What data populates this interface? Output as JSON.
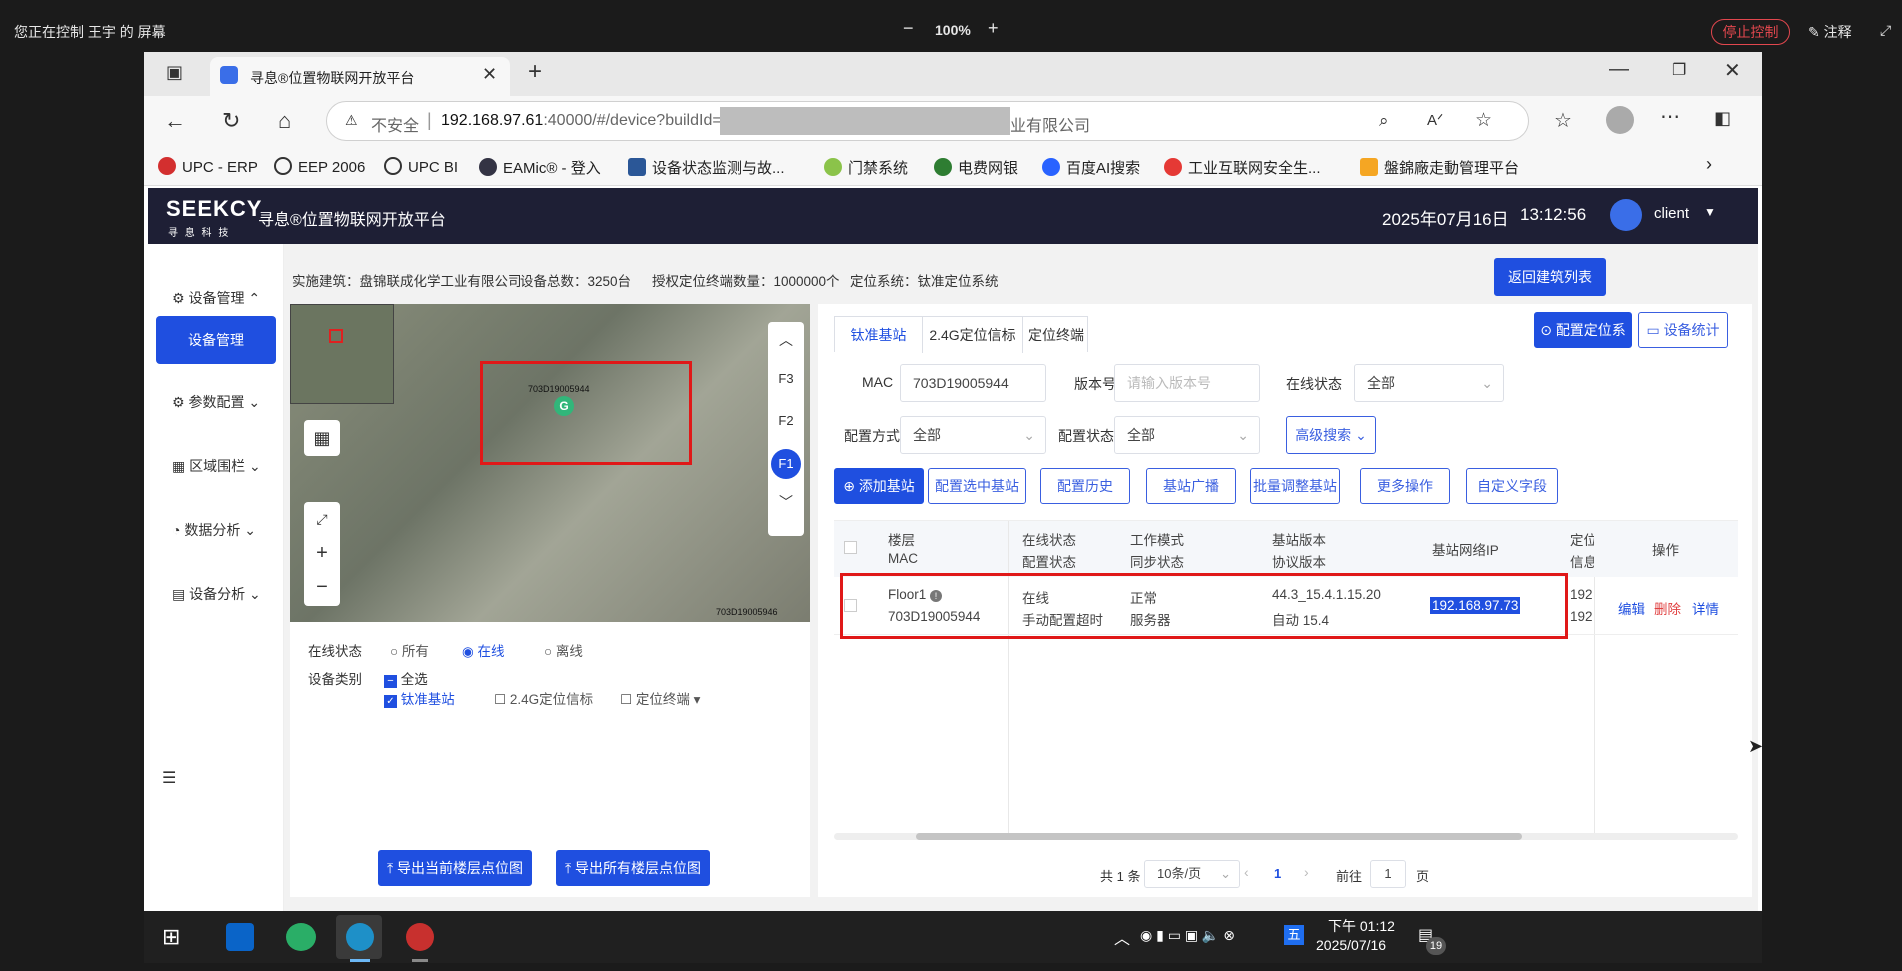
{
  "remote_bar": {
    "status": "您正在控制 王宇 的 屏幕",
    "zoom": "100%",
    "minus": "−",
    "plus": "+",
    "stop": "停止控制",
    "annotate": "注释"
  },
  "browser": {
    "tab_title": "寻息®位置物联网开放平台",
    "insecure": "不安全",
    "url_host": "192.168.97.61",
    "url_rest": ":40000/#/device?buildId=2077",
    "url_tail": "业有限公司",
    "bookmarks": [
      "UPC - ERP",
      "EEP 2006",
      "UPC BI",
      "EAMic® - 登入",
      "设备状态监测与故...",
      "门禁系统",
      "电费网银",
      "百度AI搜索",
      "工业互联网安全生...",
      "盤錦廠走動管理平台"
    ]
  },
  "header": {
    "logo": "SEEKCY",
    "logo_sub": "寻 息 科 技",
    "title": "寻息®位置物联网开放平台",
    "date": "2025年07月16日",
    "time": "13:12:56",
    "user": "client"
  },
  "sidebar": {
    "items": [
      "设备管理",
      "参数配置",
      "区域围栏",
      "数据分析",
      "设备分析"
    ],
    "active": "设备管理"
  },
  "info_bar": {
    "building": "实施建筑：盘锦联成化学工业有限公司",
    "total": "设备总数：3250台",
    "licensed": "授权定位终端数量：1000000个",
    "system": "定位系统：钛准定位系统",
    "back_button": "返回建筑列表"
  },
  "map": {
    "marker_label": "703D19005944",
    "corner_label": "703D19005946",
    "floors": [
      "F3",
      "F2",
      "F1"
    ],
    "active_floor": "F1",
    "online_label": "在线状态",
    "online_options": [
      "所有",
      "在线",
      "离线"
    ],
    "online_selected": "在线",
    "type_label": "设备类别",
    "types": [
      "全选",
      "钛准基站",
      "2.4G定位信标",
      "定位终端"
    ],
    "export_current": "导出当前楼层点位图",
    "export_all": "导出所有楼层点位图"
  },
  "tabs": [
    "钛准基站",
    "2.4G定位信标",
    "定位终端"
  ],
  "top_buttons": {
    "config_system": "配置定位系统",
    "stats": "设备统计"
  },
  "filters": {
    "mac_label": "MAC",
    "mac_value": "703D19005944",
    "version_label": "版本号",
    "version_placeholder": "请输入版本号",
    "online_label": "在线状态",
    "online_value": "全部",
    "config_mode_label": "配置方式",
    "config_mode_value": "全部",
    "config_state_label": "配置状态",
    "config_state_value": "全部",
    "advanced": "高级搜索"
  },
  "actions": [
    "添加基站",
    "配置选中基站",
    "配置历史",
    "基站广播",
    "批量调整基站",
    "更多操作",
    "自定义字段"
  ],
  "table": {
    "headers": [
      [
        "楼层",
        "MAC"
      ],
      [
        "在线状态",
        "配置状态"
      ],
      [
        "工作模式",
        "同步状态"
      ],
      [
        "基站版本",
        "协议版本"
      ],
      [
        "基站网络IP",
        ""
      ],
      [
        "定位",
        "信息"
      ],
      [
        "操作",
        ""
      ]
    ],
    "row": {
      "floor": "Floor1",
      "mac": "703D19005944",
      "online": "在线",
      "config": "手动配置超时",
      "mode": "正常",
      "sync": "服务器",
      "version": "44.3_15.4.1.15.20",
      "protocol": "自动 15.4",
      "ip": "192.168.97.73",
      "pos1": "192",
      "pos2": "192",
      "edit": "编辑",
      "delete": "删除",
      "detail": "详情"
    }
  },
  "pagination": {
    "total": "共 1 条",
    "page_size": "10条/页",
    "page": "1",
    "goto_label": "前往",
    "goto_value": "1",
    "page_unit": "页"
  },
  "taskbar": {
    "time": "下午 01:12",
    "date": "2025/07/16",
    "ime": "五",
    "notifications": "19"
  }
}
